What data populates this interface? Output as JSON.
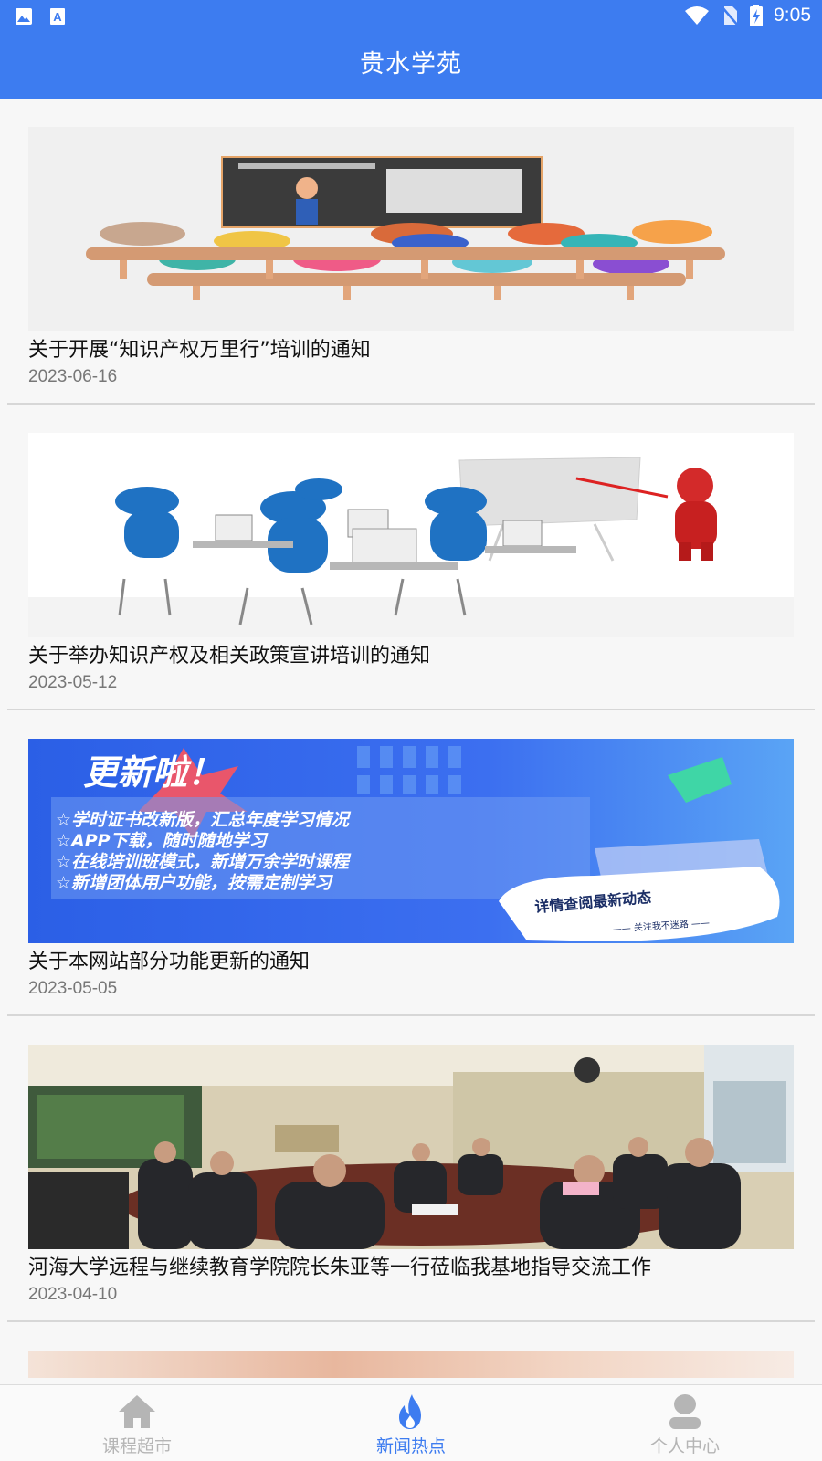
{
  "status_bar": {
    "time": "9:05",
    "icons": [
      "image-icon",
      "a-icon",
      "wifi-icon",
      "no-sim-icon",
      "battery-charging-icon"
    ]
  },
  "app_bar": {
    "title": "贵水学苑"
  },
  "news": [
    {
      "title": "关于开展“知识产权万里行”培训的通知",
      "date": "2023-06-16",
      "image": "classroom-illustration"
    },
    {
      "title": "关于举办知识产权及相关政策宣讲培训的通知",
      "date": "2023-05-12",
      "image": "training-figures-illustration"
    },
    {
      "title": "关于本网站部分功能更新的通知",
      "date": "2023-05-05",
      "image": "update-banner",
      "banner": {
        "headline": "更新啦！",
        "lines": [
          "☆学时证书改新版，汇总年度学习情况",
          "☆APP下载，随时随地学习",
          "☆在线培训班模式，新增万余学时课程",
          "☆新增团体用户功能，按需定制学习"
        ],
        "bubble": "详情查阅最新动态",
        "bubble_sub": "—— 关注我不迷路 ——"
      }
    },
    {
      "title": "河海大学远程与继续教育学院院长朱亚等一行莅临我基地指导交流工作",
      "date": "2023-04-10",
      "image": "meeting-photo"
    }
  ],
  "tab_bar": {
    "items": [
      {
        "label": "课程超市",
        "icon": "home-icon",
        "active": false
      },
      {
        "label": "新闻热点",
        "icon": "flame-icon",
        "active": true
      },
      {
        "label": "个人中心",
        "icon": "person-icon",
        "active": false
      }
    ]
  },
  "colors": {
    "primary": "#3d7cf0",
    "inactive": "#b5b5b5",
    "background": "#f7f7f7"
  }
}
